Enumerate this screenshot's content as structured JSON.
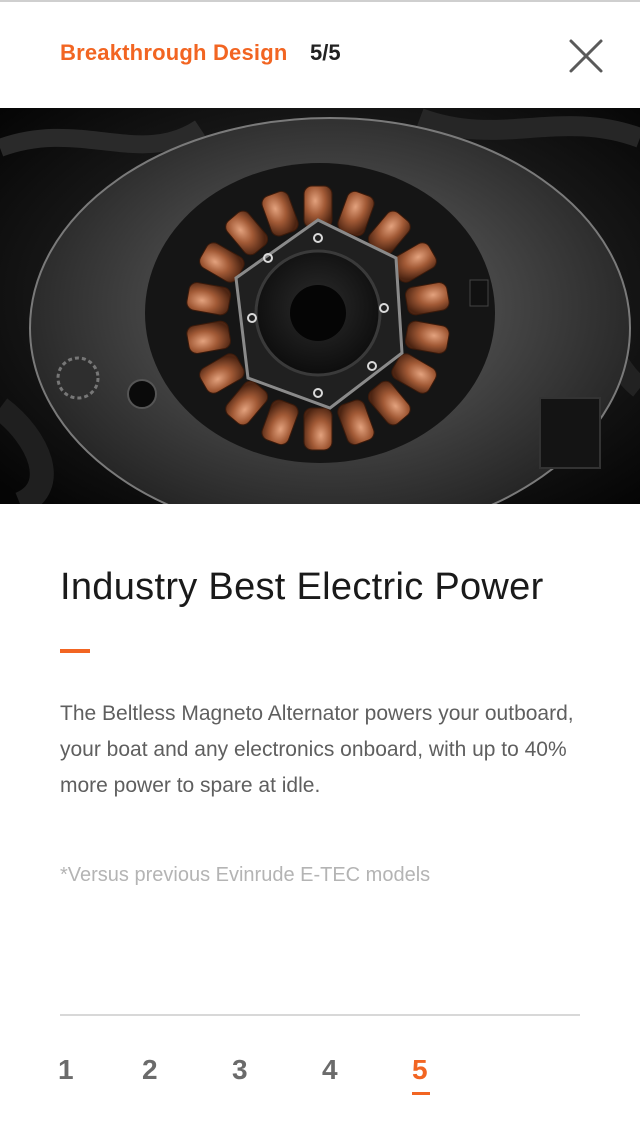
{
  "header": {
    "title": "Breakthrough Design",
    "count": "5/5",
    "close_icon": "close-icon"
  },
  "hero": {
    "image": "alternator-stator-photo"
  },
  "content": {
    "headline": "Industry Best Electric Power",
    "body": "The Beltless Magneto Alternator powers your outboard, your boat and any electronics onboard, with up to 40% more power to spare at idle.",
    "footnote": "*Versus previous Evinrude E-TEC models"
  },
  "pager": {
    "items": [
      "1",
      "2",
      "3",
      "4",
      "5"
    ],
    "active_index": 4
  },
  "colors": {
    "accent": "#f26522",
    "text": "#1a1a1a",
    "body_text": "#5f5f5f",
    "footnote": "#b4b4b4"
  }
}
